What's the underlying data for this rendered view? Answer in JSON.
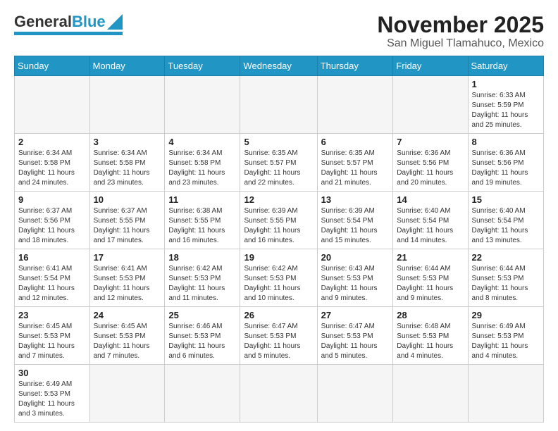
{
  "header": {
    "title": "November 2025",
    "subtitle": "San Miguel Tlamahuco, Mexico",
    "logo_general": "General",
    "logo_blue": "Blue"
  },
  "weekdays": [
    "Sunday",
    "Monday",
    "Tuesday",
    "Wednesday",
    "Thursday",
    "Friday",
    "Saturday"
  ],
  "weeks": [
    [
      {
        "num": "",
        "info": ""
      },
      {
        "num": "",
        "info": ""
      },
      {
        "num": "",
        "info": ""
      },
      {
        "num": "",
        "info": ""
      },
      {
        "num": "",
        "info": ""
      },
      {
        "num": "",
        "info": ""
      },
      {
        "num": "1",
        "info": "Sunrise: 6:33 AM\nSunset: 5:59 PM\nDaylight: 11 hours\nand 25 minutes."
      }
    ],
    [
      {
        "num": "2",
        "info": "Sunrise: 6:34 AM\nSunset: 5:58 PM\nDaylight: 11 hours\nand 24 minutes."
      },
      {
        "num": "3",
        "info": "Sunrise: 6:34 AM\nSunset: 5:58 PM\nDaylight: 11 hours\nand 23 minutes."
      },
      {
        "num": "4",
        "info": "Sunrise: 6:34 AM\nSunset: 5:58 PM\nDaylight: 11 hours\nand 23 minutes."
      },
      {
        "num": "5",
        "info": "Sunrise: 6:35 AM\nSunset: 5:57 PM\nDaylight: 11 hours\nand 22 minutes."
      },
      {
        "num": "6",
        "info": "Sunrise: 6:35 AM\nSunset: 5:57 PM\nDaylight: 11 hours\nand 21 minutes."
      },
      {
        "num": "7",
        "info": "Sunrise: 6:36 AM\nSunset: 5:56 PM\nDaylight: 11 hours\nand 20 minutes."
      },
      {
        "num": "8",
        "info": "Sunrise: 6:36 AM\nSunset: 5:56 PM\nDaylight: 11 hours\nand 19 minutes."
      }
    ],
    [
      {
        "num": "9",
        "info": "Sunrise: 6:37 AM\nSunset: 5:56 PM\nDaylight: 11 hours\nand 18 minutes."
      },
      {
        "num": "10",
        "info": "Sunrise: 6:37 AM\nSunset: 5:55 PM\nDaylight: 11 hours\nand 17 minutes."
      },
      {
        "num": "11",
        "info": "Sunrise: 6:38 AM\nSunset: 5:55 PM\nDaylight: 11 hours\nand 16 minutes."
      },
      {
        "num": "12",
        "info": "Sunrise: 6:39 AM\nSunset: 5:55 PM\nDaylight: 11 hours\nand 16 minutes."
      },
      {
        "num": "13",
        "info": "Sunrise: 6:39 AM\nSunset: 5:54 PM\nDaylight: 11 hours\nand 15 minutes."
      },
      {
        "num": "14",
        "info": "Sunrise: 6:40 AM\nSunset: 5:54 PM\nDaylight: 11 hours\nand 14 minutes."
      },
      {
        "num": "15",
        "info": "Sunrise: 6:40 AM\nSunset: 5:54 PM\nDaylight: 11 hours\nand 13 minutes."
      }
    ],
    [
      {
        "num": "16",
        "info": "Sunrise: 6:41 AM\nSunset: 5:54 PM\nDaylight: 11 hours\nand 12 minutes."
      },
      {
        "num": "17",
        "info": "Sunrise: 6:41 AM\nSunset: 5:53 PM\nDaylight: 11 hours\nand 12 minutes."
      },
      {
        "num": "18",
        "info": "Sunrise: 6:42 AM\nSunset: 5:53 PM\nDaylight: 11 hours\nand 11 minutes."
      },
      {
        "num": "19",
        "info": "Sunrise: 6:42 AM\nSunset: 5:53 PM\nDaylight: 11 hours\nand 10 minutes."
      },
      {
        "num": "20",
        "info": "Sunrise: 6:43 AM\nSunset: 5:53 PM\nDaylight: 11 hours\nand 9 minutes."
      },
      {
        "num": "21",
        "info": "Sunrise: 6:44 AM\nSunset: 5:53 PM\nDaylight: 11 hours\nand 9 minutes."
      },
      {
        "num": "22",
        "info": "Sunrise: 6:44 AM\nSunset: 5:53 PM\nDaylight: 11 hours\nand 8 minutes."
      }
    ],
    [
      {
        "num": "23",
        "info": "Sunrise: 6:45 AM\nSunset: 5:53 PM\nDaylight: 11 hours\nand 7 minutes."
      },
      {
        "num": "24",
        "info": "Sunrise: 6:45 AM\nSunset: 5:53 PM\nDaylight: 11 hours\nand 7 minutes."
      },
      {
        "num": "25",
        "info": "Sunrise: 6:46 AM\nSunset: 5:53 PM\nDaylight: 11 hours\nand 6 minutes."
      },
      {
        "num": "26",
        "info": "Sunrise: 6:47 AM\nSunset: 5:53 PM\nDaylight: 11 hours\nand 5 minutes."
      },
      {
        "num": "27",
        "info": "Sunrise: 6:47 AM\nSunset: 5:53 PM\nDaylight: 11 hours\nand 5 minutes."
      },
      {
        "num": "28",
        "info": "Sunrise: 6:48 AM\nSunset: 5:53 PM\nDaylight: 11 hours\nand 4 minutes."
      },
      {
        "num": "29",
        "info": "Sunrise: 6:49 AM\nSunset: 5:53 PM\nDaylight: 11 hours\nand 4 minutes."
      }
    ],
    [
      {
        "num": "30",
        "info": "Sunrise: 6:49 AM\nSunset: 5:53 PM\nDaylight: 11 hours\nand 3 minutes."
      },
      {
        "num": "",
        "info": ""
      },
      {
        "num": "",
        "info": ""
      },
      {
        "num": "",
        "info": ""
      },
      {
        "num": "",
        "info": ""
      },
      {
        "num": "",
        "info": ""
      },
      {
        "num": "",
        "info": ""
      }
    ]
  ]
}
